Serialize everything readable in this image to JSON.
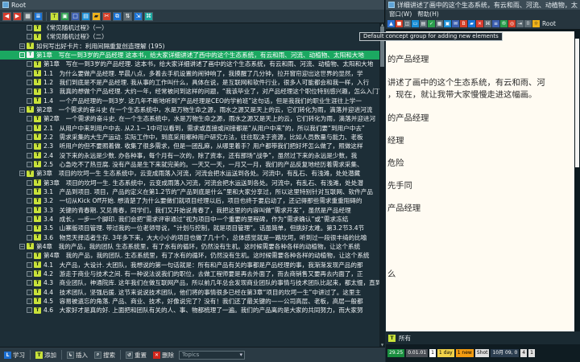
{
  "left": {
    "title": "Root",
    "tree": [
      {
        "level": 1,
        "label": "《常见随机过程》（一）"
      },
      {
        "level": 1,
        "label": "《常见随机过程》（二）"
      },
      {
        "level": 0,
        "label": "如何写出好卡片：利用间隔重复创造理解 (195)"
      },
      {
        "level": 0,
        "label": "第1章　写在一到3岁的产品经理 这本书，给大家详细讲述了西中的这个生态系统，有云和雨、河流、动植物、太阳和大地",
        "selected": true
      },
      {
        "level": 1,
        "label": "第1章　写在一到3岁的产品经理. 这本书，给大家详细讲述了画中的这个生态系统，有云和雨、河流、动植物、太阳和大地"
      },
      {
        "level": 1,
        "label": "1.1　为什么要做产品经理. 早晨八点，多着去手机设置的闹钟响了，我摸醒了几分钟，拉开窗帘迎出这世界的显然，学"
      },
      {
        "level": 1,
        "label": "1.2　我们到底是不是产品经理. 我从事的工作叫什么，具体在说，是互联网和软件行业，很多人可能都会和我一样，入行"
      },
      {
        "level": 1,
        "label": "1.3　我真的想做个产品经理. 大约一年，经常被问到这样的问题，“我该毕业了，对产品经理这个职位特别感兴趣，怎么入门？”"
      },
      {
        "level": 1,
        "label": "1.4　一个产品经理的一到3岁. 这几年不断地听到“产品经理是CEO的学前班”这句话，但是我我们的职业生涯往上学一"
      },
      {
        "level": 0,
        "label": "第2章　一个需求的奋斗史 在一个生态系统中，水是万物生命之源，雨水之源又是天上的云，它们转化为雨，滴落并迎进河流"
      },
      {
        "level": 1,
        "label": "第2章　一个需求的奋斗史. 在一个生态系统中，水是万物生命之源，雨水之源又是天上的云，它们转化为雨，滴落并迎进河"
      },
      {
        "level": 1,
        "label": "2.1　从用户中来到用户中去. 从2.1－1中可以看到，需求或直接或间接都是“从用户中来”的，所以我们要“到用户中去”"
      },
      {
        "level": 1,
        "label": "2.2　需求采集的大生产运动. 实际工作中，到底采用哪种用户研究方法，往往取决于资源，比如人员数量与能力、老板"
      },
      {
        "level": 1,
        "label": "2.3　听用户的但不要照着做. 收集了很多需求，但是一团乱麻，从哪里着手？用户都带我们把好坏怎么做了，照做这样"
      },
      {
        "level": 1,
        "label": "2.4　没下来的永远是少数. 办各种事，每个月有一次的，除了资本，还有那场“战争”，虽然过下来的永远是少数，我"
      },
      {
        "level": 1,
        "label": "2.5　心急吃不了热豆腐. 没有产品是生下来就完美的。一天又一天，一月又一月，我们的产品反复地经历着需求采集、"
      },
      {
        "level": 0,
        "label": "第3章　项目的坎坷一生 生态系统中，云变成雨落入河流，河流会把水运送到各处。河流中，有乱石、有浅滩，处处潜藏"
      },
      {
        "level": 1,
        "label": "第3章　项目的坎坷一生. 生态系统中，云变成雨落入河流，河流会把水运送到各处。河流中，有乱石、有浅滩，处处潜"
      },
      {
        "level": 1,
        "label": "3.1　产品到项目. 项目，产品的定义在第1.2节的“产品到底是什么”里和大家分享过，所以这里特别针对互联网、软件产品"
      },
      {
        "level": 1,
        "label": "3.2　一切从Kick Off开始. 想清楚了为什么要做们就项目经理以后，项目也终于要启动了，还记得那些需求重重阻碍的"
      },
      {
        "level": 1,
        "label": "3.3　关键的青春期. 又见青春，同学们，我们又开始说青春了，我把这里的内容叫做“需求开发”，虽然是产品经理"
      },
      {
        "level": 1,
        "label": "3.4　成长，一步一个脚印. 我们会把“需求评审通过”视为项目中一个重要的里程碑，作为“需求确认”或“需求冻结"
      },
      {
        "level": 1,
        "label": "3.5　山寨版项目管理. 带过我的一位老领导说，“计划与控制，就是项目管理”。话虽简单，但挑好太难。第3.2节3.4节"
      },
      {
        "level": 1,
        "label": "3.6　物竞天择适者生存. 3年多下来，大大小小的项目也做了几十个，总体感觉就是一路坎坷，听到过一段很丰绮的比喻"
      },
      {
        "level": 0,
        "label": "第4章　我的产品，我的团队 生态系统里，有了水有的循环，仍然没有生机。这时候需要各种各样的动植物，让这个系统"
      },
      {
        "level": 1,
        "label": "第4章　我的产品，我的团队. 生态系统里，有了水有的循环，仍然没有生机。这时候需要各种各样的动植物，让这个系统"
      },
      {
        "level": 1,
        "label": "4.1　大产品，大设计. 大团队，我想说的第一句话就是：所有和产品有关的事都是产品经理的事，我渐渐发现产品的那"
      },
      {
        "level": 1,
        "label": "4.2　游走于商业与技术之间. 有一种说法说我们的职位，去做工程师要是再去外面了，而去商销售又要再去内面了，正"
      },
      {
        "level": 1,
        "label": "4.3　商业团队，神通院库. 这年我们在做互联网产品，所以前几年总会发现商业团队的事情与技术团队比起来，都太慢，直到"
      },
      {
        "level": 1,
        "label": "4.4　技术团队，坚强后援. 这节来说说技术团队，他们将的事情很多已经在第3章“项目的坎坷一生”中讲过了。这里主"
      },
      {
        "level": 1,
        "label": "4.5　容易被遗忘的角落. 产品、商业、技术，好像说完了？没有！我们还了最关键的——公司高层、老板，高层一般都"
      },
      {
        "level": 1,
        "label": "4.6　大家好才是真的好. 上面把和团队有关的人、事、物都梳理了一遍。我们的产品离的是大家的共同努力，而大家努"
      }
    ],
    "bottom": {
      "study": "学习",
      "add": "添加",
      "insert": "插入",
      "search": "搜索",
      "review": "重置",
      "delete": "删除",
      "topic_placeholder": "Topics"
    }
  },
  "tooltip": "Default concept group for adding new elements",
  "right": {
    "title": "详细讲述了画中的这个生态系统，有云和雨、河流、动植物，太阳和大...",
    "menu": [
      "窗口(W)",
      "帮助(H)"
    ],
    "toolbar_name": "Root",
    "paragraphs": [
      "的产品经理",
      "讲述了画中的这个生态系统，有云和雨、河",
      "，现在，就让我带大家慢慢走进这幅画。",
      "的产品经理",
      "经理",
      "危险",
      "先手同",
      "产品经理",
      "么"
    ],
    "footer_label": "所有",
    "status": [
      {
        "text": "29.25",
        "bg": "#1a8f3f",
        "fg": "#ffffff"
      },
      {
        "text": "0.01.01",
        "bg": "#4b4f56",
        "fg": "#ffffff"
      },
      {
        "text": "1",
        "bg": "#ffffff",
        "fg": "#000000"
      },
      {
        "text": "1 day",
        "bg": "#f1d24a",
        "fg": "#000000"
      },
      {
        "text": "1 new",
        "bg": "#f39c12",
        "fg": "#000000"
      },
      {
        "text": "Shot",
        "bg": "#e0e0e0",
        "fg": "#000000"
      },
      {
        "text": "10月 09, 0",
        "bg": "#2c3e50",
        "fg": "#ffffff"
      },
      {
        "text": "4",
        "bg": "#e0e0e0",
        "fg": "#000000"
      },
      {
        "text": "1",
        "bg": "#e0e0e0",
        "fg": "#000000"
      }
    ]
  }
}
